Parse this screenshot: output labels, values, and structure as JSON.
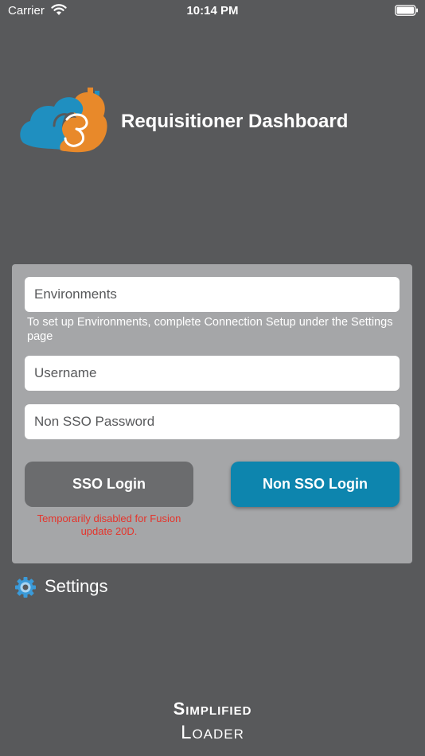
{
  "status_bar": {
    "carrier": "Carrier",
    "time": "10:14 PM"
  },
  "header": {
    "title": "Requisitioner Dashboard"
  },
  "login": {
    "environments_placeholder": "Environments",
    "environments_hint": "To set up Environments, complete Connection Setup under the Settings page",
    "username_placeholder": "Username",
    "password_placeholder": "Non SSO Password",
    "sso_button": "SSO Login",
    "non_sso_button": "Non SSO Login",
    "sso_warning": "Temporarily disabled for Fusion update 20D."
  },
  "settings": {
    "label": "Settings"
  },
  "footer": {
    "brand_line1": "Simplified",
    "brand_line2": "Loader"
  },
  "colors": {
    "background": "#58595b",
    "card": "#a5a6a8",
    "primary_button": "#0d85ae",
    "disabled_button": "#6b6c6e",
    "warning_text": "#e5342b",
    "logo_blue": "#1f8fc0",
    "logo_orange": "#e8892a"
  }
}
